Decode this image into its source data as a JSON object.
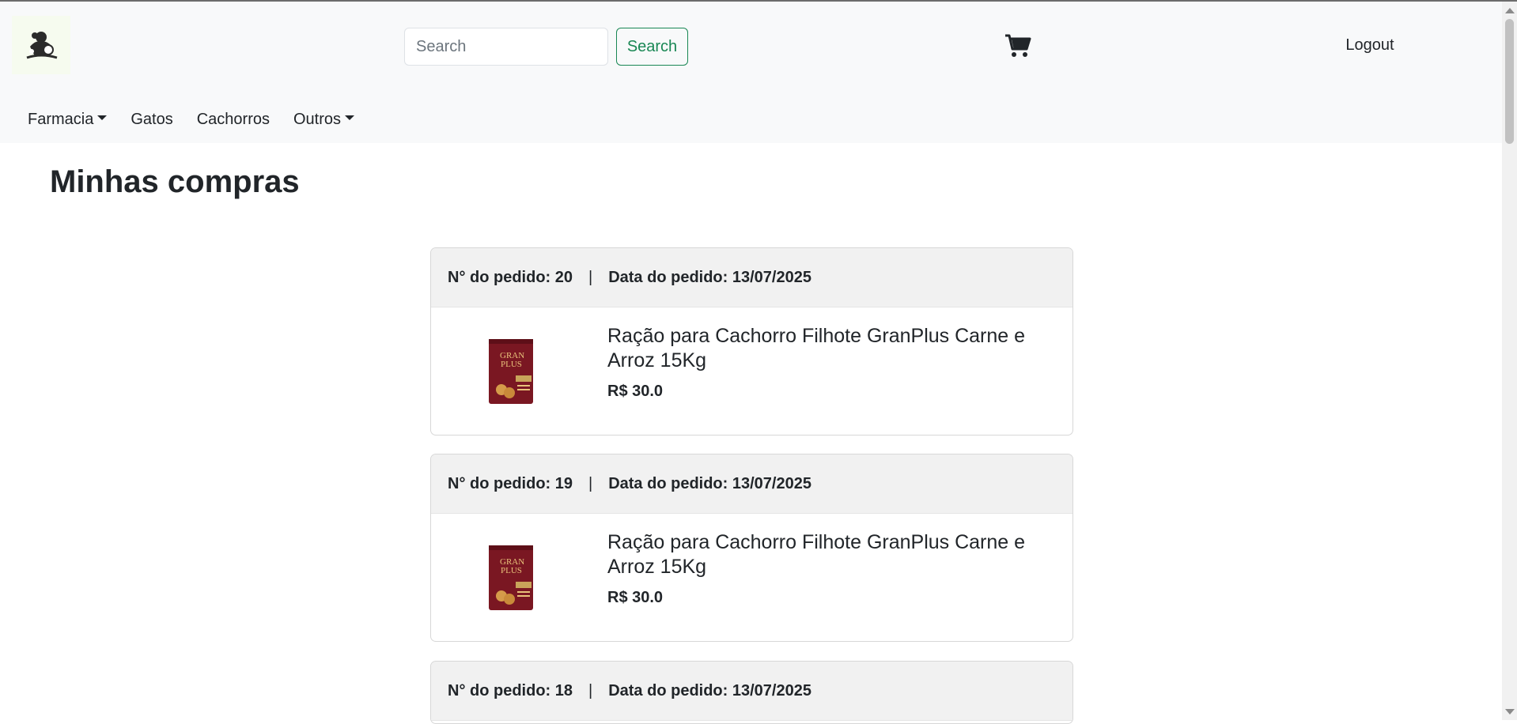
{
  "navbar": {
    "logo": "pet-shop-logo",
    "search": {
      "placeholder": "Search",
      "value": ""
    },
    "search_button": "Search",
    "cart_icon": "shopping-cart-icon",
    "logout": "Logout",
    "menu": [
      {
        "label": "Farmacia",
        "dropdown": true
      },
      {
        "label": "Gatos",
        "dropdown": false
      },
      {
        "label": "Cachorros",
        "dropdown": false
      },
      {
        "label": "Outros",
        "dropdown": true
      }
    ]
  },
  "page": {
    "title": "Minhas compras"
  },
  "orders": [
    {
      "number_label": "N° do pedido: 20",
      "separator": "|",
      "date_label": "Data do pedido: 13/07/2025",
      "product": {
        "name": "Ração para Cachorro Filhote GranPlus Carne e Arroz 15Kg",
        "price": "R$ 30.0"
      }
    },
    {
      "number_label": "N° do pedido: 19",
      "separator": "|",
      "date_label": "Data do pedido: 13/07/2025",
      "product": {
        "name": "Ração para Cachorro Filhote GranPlus Carne e Arroz 15Kg",
        "price": "R$ 30.0"
      }
    },
    {
      "number_label": "N° do pedido: 18",
      "separator": "|",
      "date_label": "Data do pedido: 13/07/2025"
    }
  ],
  "product_image": {
    "brand_text": [
      "GRAN",
      "PLUS"
    ],
    "colors": {
      "bag": "#7a1722",
      "accent": "#e8c27a"
    }
  },
  "colors": {
    "accent": "#198754",
    "navbar_bg": "#f8f9fa",
    "card_header_bg": "#f1f1f1"
  }
}
